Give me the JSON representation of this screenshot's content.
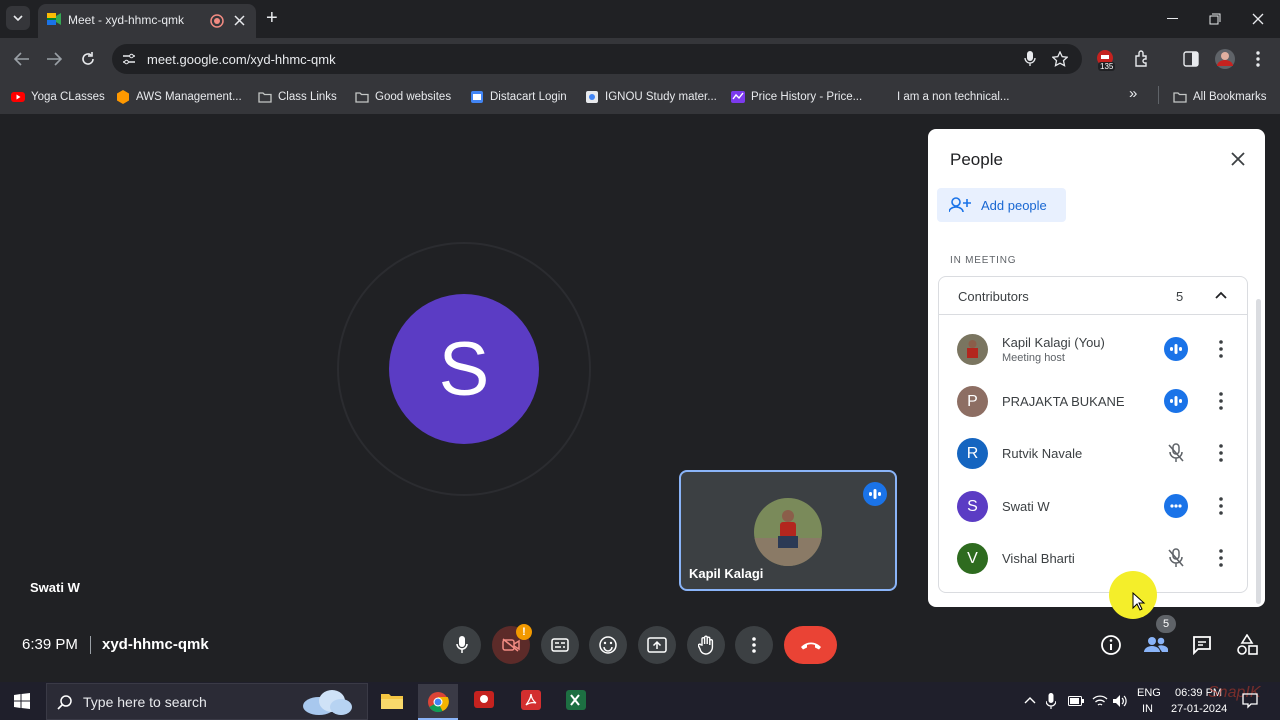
{
  "browser": {
    "tab_title": "Meet - xyd-hhmc-qmk",
    "new_tab_glyph": "+",
    "url": "meet.google.com/xyd-hhmc-qmk",
    "extension_badge": "135",
    "bookmarks": [
      {
        "label": "Yoga CLasses",
        "icon": "youtube-icon",
        "color": "#ff0000"
      },
      {
        "label": "AWS Management...",
        "icon": "aws-cube-icon",
        "color": "#ff9900"
      },
      {
        "label": "Class Links",
        "icon": "folder-icon",
        "color": "#c4c7c5"
      },
      {
        "label": "Good websites",
        "icon": "folder-icon",
        "color": "#c4c7c5"
      },
      {
        "label": "Distacart Login",
        "icon": "site-icon",
        "color": "#4285f4"
      },
      {
        "label": "IGNOU Study mater...",
        "icon": "site-icon",
        "color": "#e8eaed"
      },
      {
        "label": "Price History - Price...",
        "icon": "price-history-icon",
        "color": "#7c3aed"
      },
      {
        "label": "I am a non technical...",
        "icon": "",
        "color": ""
      }
    ],
    "all_bookmarks": "All Bookmarks",
    "overflow_glyph": "»"
  },
  "meeting": {
    "main_avatar_letter": "S",
    "main_name": "Swati W",
    "self_tile_name": "Kapil Kalagi",
    "time": "6:39 PM",
    "code": "xyd-hhmc-qmk",
    "camera_alert_glyph": "!",
    "people_count_badge": "5"
  },
  "panel": {
    "title": "People",
    "add_people": "Add people",
    "section": "IN MEETING",
    "group_label": "Contributors",
    "group_count": "5",
    "people": [
      {
        "name": "Kapil Kalagi (You)",
        "sub": "Meeting host",
        "letter": "",
        "avatar_color": "#6b5a4a",
        "status": "speaking"
      },
      {
        "name": "PRAJAKTA BUKANE",
        "sub": "",
        "letter": "P",
        "avatar_color": "#8d6e63",
        "status": "speaking"
      },
      {
        "name": "Rutvik Navale",
        "sub": "",
        "letter": "R",
        "avatar_color": "#1565c0",
        "status": "muted"
      },
      {
        "name": "Swati W",
        "sub": "",
        "letter": "S",
        "avatar_color": "#5b3cc4",
        "status": "idle"
      },
      {
        "name": "Vishal Bharti",
        "sub": "",
        "letter": "V",
        "avatar_color": "#2e6b1f",
        "status": "muted"
      }
    ]
  },
  "taskbar": {
    "search_placeholder": "Type here to search",
    "lang_top": "ENG",
    "lang_bottom": "IN",
    "clock_time": "06:39 PM",
    "clock_date": "27-01-2024",
    "watermark": "SnapIK"
  },
  "colors": {
    "accent_blue": "#1a73e8",
    "end_call_red": "#ea4335",
    "avatar_purple": "#5b3cc4",
    "tile_border": "#8ab4f8"
  }
}
